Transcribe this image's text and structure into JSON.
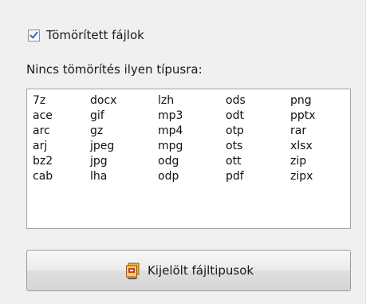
{
  "compressed_files": {
    "checked": true,
    "label": "Tömörített fájlok"
  },
  "no_compression_label": "Nincs tömörítés ilyen típusra:",
  "extensions": {
    "columns": [
      [
        "7z",
        "ace",
        "arc",
        "arj",
        "bz2",
        "cab"
      ],
      [
        "docx",
        "gif",
        "gz",
        "jpeg",
        "jpg",
        "lha"
      ],
      [
        "lzh",
        "mp3",
        "mp4",
        "mpg",
        "odg",
        "odp"
      ],
      [
        "ods",
        "odt",
        "otp",
        "ots",
        "ott",
        "pdf"
      ],
      [
        "png",
        "pptx",
        "rar",
        "xlsx",
        "zip",
        "zipx"
      ]
    ]
  },
  "select_button": {
    "label": "Kijelölt fájltipusok",
    "icon": "file-types-icon"
  },
  "colors": {
    "panel_bg": "#f0f0f0",
    "list_bg": "#ffffff",
    "check": "#2a6fc9"
  }
}
